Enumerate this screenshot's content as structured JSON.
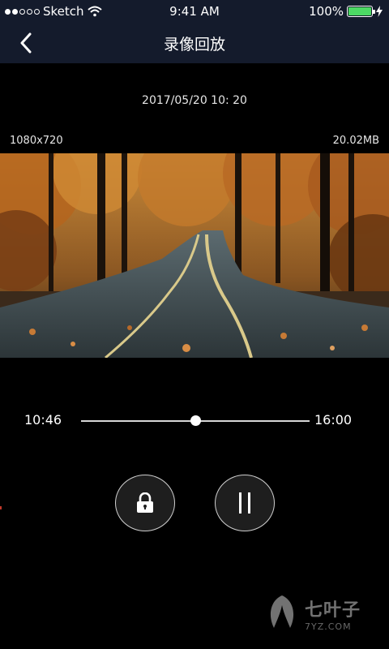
{
  "status_bar": {
    "carrier": "Sketch",
    "time": "9:41 AM",
    "battery_percent": "100%",
    "battery_level": 1.0,
    "signal_dots_filled": 2,
    "signal_dots_total": 5
  },
  "nav": {
    "title": "录像回放",
    "back_icon": "chevron-left-icon"
  },
  "recording": {
    "datetime": "2017/05/20 10: 20",
    "resolution": "1080x720",
    "file_size": "20.02MB"
  },
  "player": {
    "current_time": "10:46",
    "end_time": "16:00",
    "progress": 0.5,
    "lock_icon": "lock-icon",
    "pause_icon": "pause-icon"
  },
  "watermark": {
    "name": "七叶子",
    "domain": "7YZ.COM"
  },
  "colors": {
    "bar_background": "#141b2c",
    "battery_green": "#4cd964",
    "background": "#000000"
  }
}
